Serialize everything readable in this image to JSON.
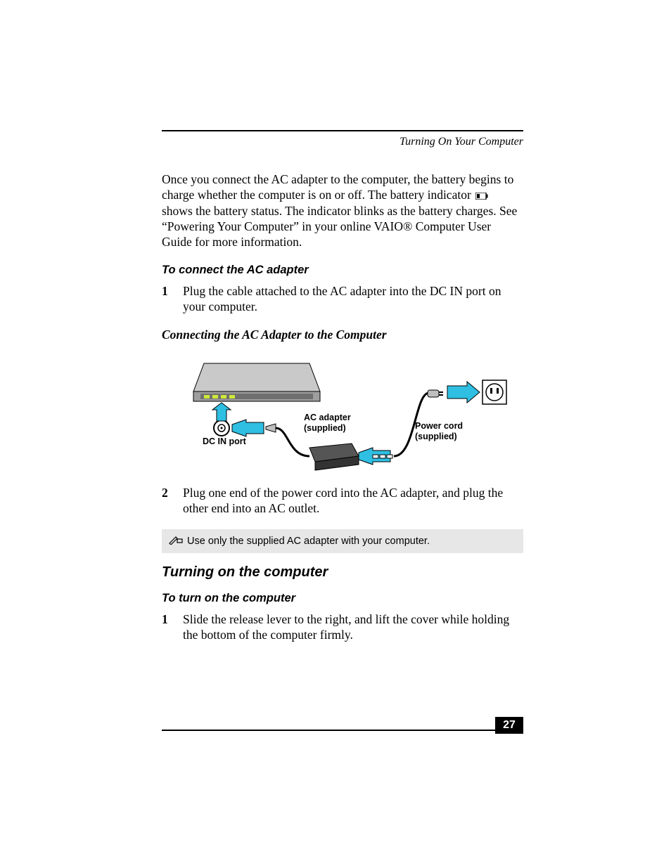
{
  "header": {
    "running_title": "Turning On Your Computer"
  },
  "intro": {
    "part1": "Once you connect the AC adapter to the computer, the battery begins to charge whether the computer is on or off. The battery indicator ",
    "part2": " shows the battery status. The indicator blinks as the battery charges. See “Powering Your Computer” in your online VAIO® Computer User Guide for more information."
  },
  "connect": {
    "heading": "To connect the AC adapter",
    "step1_num": "1",
    "step1_text": "Plug the cable attached to the AC adapter into the DC IN port on your computer.",
    "figure_caption": "Connecting the AC Adapter to the Computer",
    "labels": {
      "dc_in": "DC IN port",
      "ac_adapter_l1": "AC adapter",
      "ac_adapter_l2": "(supplied)",
      "power_cord_l1": "Power cord",
      "power_cord_l2": "(supplied)"
    },
    "step2_num": "2",
    "step2_text": "Plug one end of the power cord into the AC adapter, and plug the other end into an AC outlet."
  },
  "note": {
    "text": "Use only the supplied AC adapter with your computer."
  },
  "turn_on": {
    "heading": "Turning on the computer",
    "sub_heading": "To turn on the computer",
    "step1_num": "1",
    "step1_text": "Slide the release lever to the right, and lift the cover while holding the bottom of the computer firmly."
  },
  "page_number": "27"
}
